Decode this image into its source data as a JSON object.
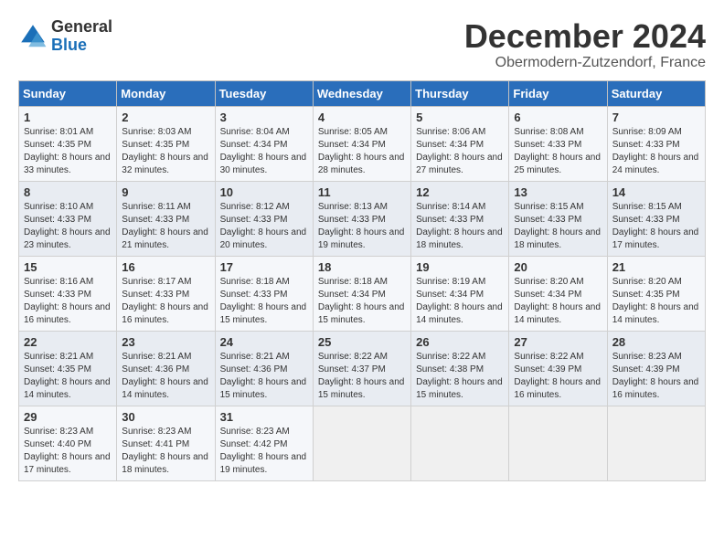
{
  "logo": {
    "general": "General",
    "blue": "Blue"
  },
  "header": {
    "month": "December 2024",
    "location": "Obermodern-Zutzendorf, France"
  },
  "days_of_week": [
    "Sunday",
    "Monday",
    "Tuesday",
    "Wednesday",
    "Thursday",
    "Friday",
    "Saturday"
  ],
  "weeks": [
    [
      {
        "day": "1",
        "sunrise": "Sunrise: 8:01 AM",
        "sunset": "Sunset: 4:35 PM",
        "daylight": "Daylight: 8 hours and 33 minutes."
      },
      {
        "day": "2",
        "sunrise": "Sunrise: 8:03 AM",
        "sunset": "Sunset: 4:35 PM",
        "daylight": "Daylight: 8 hours and 32 minutes."
      },
      {
        "day": "3",
        "sunrise": "Sunrise: 8:04 AM",
        "sunset": "Sunset: 4:34 PM",
        "daylight": "Daylight: 8 hours and 30 minutes."
      },
      {
        "day": "4",
        "sunrise": "Sunrise: 8:05 AM",
        "sunset": "Sunset: 4:34 PM",
        "daylight": "Daylight: 8 hours and 28 minutes."
      },
      {
        "day": "5",
        "sunrise": "Sunrise: 8:06 AM",
        "sunset": "Sunset: 4:34 PM",
        "daylight": "Daylight: 8 hours and 27 minutes."
      },
      {
        "day": "6",
        "sunrise": "Sunrise: 8:08 AM",
        "sunset": "Sunset: 4:33 PM",
        "daylight": "Daylight: 8 hours and 25 minutes."
      },
      {
        "day": "7",
        "sunrise": "Sunrise: 8:09 AM",
        "sunset": "Sunset: 4:33 PM",
        "daylight": "Daylight: 8 hours and 24 minutes."
      }
    ],
    [
      {
        "day": "8",
        "sunrise": "Sunrise: 8:10 AM",
        "sunset": "Sunset: 4:33 PM",
        "daylight": "Daylight: 8 hours and 23 minutes."
      },
      {
        "day": "9",
        "sunrise": "Sunrise: 8:11 AM",
        "sunset": "Sunset: 4:33 PM",
        "daylight": "Daylight: 8 hours and 21 minutes."
      },
      {
        "day": "10",
        "sunrise": "Sunrise: 8:12 AM",
        "sunset": "Sunset: 4:33 PM",
        "daylight": "Daylight: 8 hours and 20 minutes."
      },
      {
        "day": "11",
        "sunrise": "Sunrise: 8:13 AM",
        "sunset": "Sunset: 4:33 PM",
        "daylight": "Daylight: 8 hours and 19 minutes."
      },
      {
        "day": "12",
        "sunrise": "Sunrise: 8:14 AM",
        "sunset": "Sunset: 4:33 PM",
        "daylight": "Daylight: 8 hours and 18 minutes."
      },
      {
        "day": "13",
        "sunrise": "Sunrise: 8:15 AM",
        "sunset": "Sunset: 4:33 PM",
        "daylight": "Daylight: 8 hours and 18 minutes."
      },
      {
        "day": "14",
        "sunrise": "Sunrise: 8:15 AM",
        "sunset": "Sunset: 4:33 PM",
        "daylight": "Daylight: 8 hours and 17 minutes."
      }
    ],
    [
      {
        "day": "15",
        "sunrise": "Sunrise: 8:16 AM",
        "sunset": "Sunset: 4:33 PM",
        "daylight": "Daylight: 8 hours and 16 minutes."
      },
      {
        "day": "16",
        "sunrise": "Sunrise: 8:17 AM",
        "sunset": "Sunset: 4:33 PM",
        "daylight": "Daylight: 8 hours and 16 minutes."
      },
      {
        "day": "17",
        "sunrise": "Sunrise: 8:18 AM",
        "sunset": "Sunset: 4:33 PM",
        "daylight": "Daylight: 8 hours and 15 minutes."
      },
      {
        "day": "18",
        "sunrise": "Sunrise: 8:18 AM",
        "sunset": "Sunset: 4:34 PM",
        "daylight": "Daylight: 8 hours and 15 minutes."
      },
      {
        "day": "19",
        "sunrise": "Sunrise: 8:19 AM",
        "sunset": "Sunset: 4:34 PM",
        "daylight": "Daylight: 8 hours and 14 minutes."
      },
      {
        "day": "20",
        "sunrise": "Sunrise: 8:20 AM",
        "sunset": "Sunset: 4:34 PM",
        "daylight": "Daylight: 8 hours and 14 minutes."
      },
      {
        "day": "21",
        "sunrise": "Sunrise: 8:20 AM",
        "sunset": "Sunset: 4:35 PM",
        "daylight": "Daylight: 8 hours and 14 minutes."
      }
    ],
    [
      {
        "day": "22",
        "sunrise": "Sunrise: 8:21 AM",
        "sunset": "Sunset: 4:35 PM",
        "daylight": "Daylight: 8 hours and 14 minutes."
      },
      {
        "day": "23",
        "sunrise": "Sunrise: 8:21 AM",
        "sunset": "Sunset: 4:36 PM",
        "daylight": "Daylight: 8 hours and 14 minutes."
      },
      {
        "day": "24",
        "sunrise": "Sunrise: 8:21 AM",
        "sunset": "Sunset: 4:36 PM",
        "daylight": "Daylight: 8 hours and 15 minutes."
      },
      {
        "day": "25",
        "sunrise": "Sunrise: 8:22 AM",
        "sunset": "Sunset: 4:37 PM",
        "daylight": "Daylight: 8 hours and 15 minutes."
      },
      {
        "day": "26",
        "sunrise": "Sunrise: 8:22 AM",
        "sunset": "Sunset: 4:38 PM",
        "daylight": "Daylight: 8 hours and 15 minutes."
      },
      {
        "day": "27",
        "sunrise": "Sunrise: 8:22 AM",
        "sunset": "Sunset: 4:39 PM",
        "daylight": "Daylight: 8 hours and 16 minutes."
      },
      {
        "day": "28",
        "sunrise": "Sunrise: 8:23 AM",
        "sunset": "Sunset: 4:39 PM",
        "daylight": "Daylight: 8 hours and 16 minutes."
      }
    ],
    [
      {
        "day": "29",
        "sunrise": "Sunrise: 8:23 AM",
        "sunset": "Sunset: 4:40 PM",
        "daylight": "Daylight: 8 hours and 17 minutes."
      },
      {
        "day": "30",
        "sunrise": "Sunrise: 8:23 AM",
        "sunset": "Sunset: 4:41 PM",
        "daylight": "Daylight: 8 hours and 18 minutes."
      },
      {
        "day": "31",
        "sunrise": "Sunrise: 8:23 AM",
        "sunset": "Sunset: 4:42 PM",
        "daylight": "Daylight: 8 hours and 19 minutes."
      },
      null,
      null,
      null,
      null
    ]
  ]
}
